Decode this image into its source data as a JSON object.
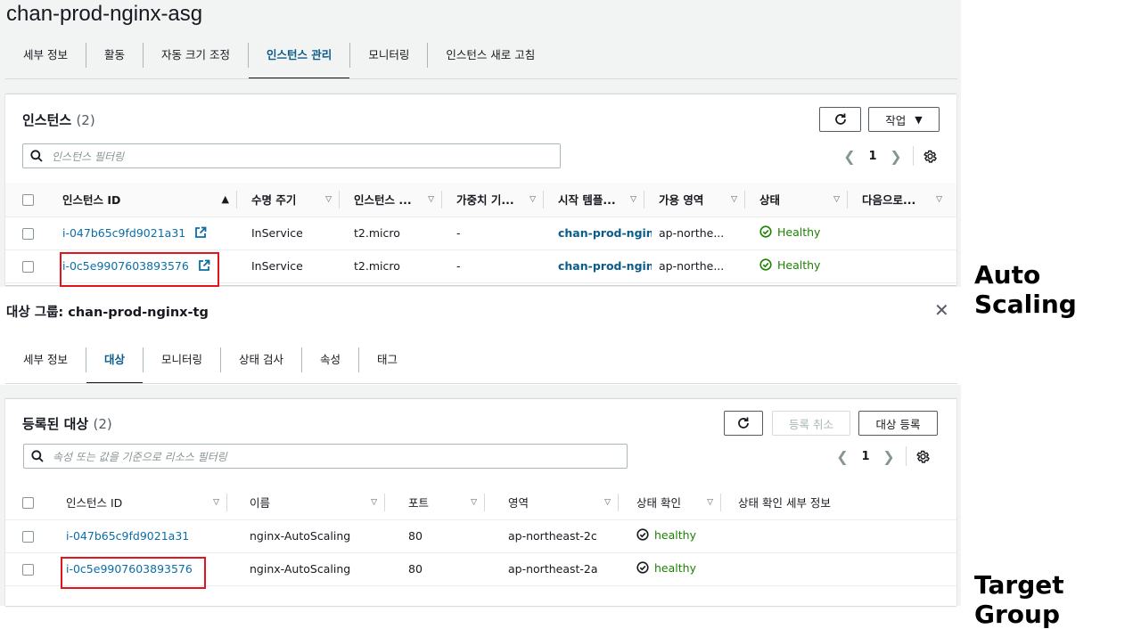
{
  "asg": {
    "title": "chan-prod-nginx-asg",
    "tabs": [
      "세부 정보",
      "활동",
      "자동 크기 조정",
      "인스턴스 관리",
      "모니터링",
      "인스턴스 새로 고침"
    ],
    "active_tab": "인스턴스 관리",
    "panel_title": "인스턴스",
    "panel_count": "(2)",
    "refresh_icon": "refresh-icon",
    "actions_label": "작업",
    "search_placeholder": "인스턴스 필터링",
    "page_number": "1",
    "columns": [
      "인스턴스 ID",
      "수명 주기",
      "인스턴스 ...",
      "가중치 기...",
      "시작 템플...",
      "가용 영역",
      "상태",
      "다음으로..."
    ],
    "rows": [
      {
        "id": "i-047b65c9fd9021a31",
        "lifecycle": "InService",
        "type": "t2.micro",
        "weight": "-",
        "template": "chan-prod-ngin",
        "az": "ap-northe...",
        "status": "Healthy"
      },
      {
        "id": "i-0c5e9907603893576",
        "lifecycle": "InService",
        "type": "t2.micro",
        "weight": "-",
        "template": "chan-prod-ngin",
        "az": "ap-northe...",
        "status": "Healthy"
      }
    ]
  },
  "tg": {
    "title": "대상 그룹: chan-prod-nginx-tg",
    "tabs": [
      "세부 정보",
      "대상",
      "모니터링",
      "상태 검사",
      "속성",
      "태그"
    ],
    "active_tab": "대상",
    "panel_title": "등록된 대상",
    "panel_count": "(2)",
    "deregister_label": "등록 취소",
    "register_label": "대상 등록",
    "search_placeholder": "속성 또는 값을 기준으로 리소스 필터링",
    "page_number": "1",
    "columns": [
      "인스턴스 ID",
      "이름",
      "포트",
      "영역",
      "상태 확인",
      "상태 확인 세부 정보"
    ],
    "rows": [
      {
        "id": "i-047b65c9fd9021a31",
        "name": "nginx-AutoScaling",
        "port": "80",
        "zone": "ap-northeast-2c",
        "health": "healthy"
      },
      {
        "id": "i-0c5e9907603893576",
        "name": "nginx-AutoScaling",
        "port": "80",
        "zone": "ap-northeast-2a",
        "health": "healthy"
      }
    ]
  },
  "labels": {
    "auto_scaling": "Auto Scaling",
    "target_group": "Target Group"
  },
  "colors": {
    "link": "#0a6ea8",
    "healthy": "#1d8102",
    "highlight": "#e0161c"
  }
}
